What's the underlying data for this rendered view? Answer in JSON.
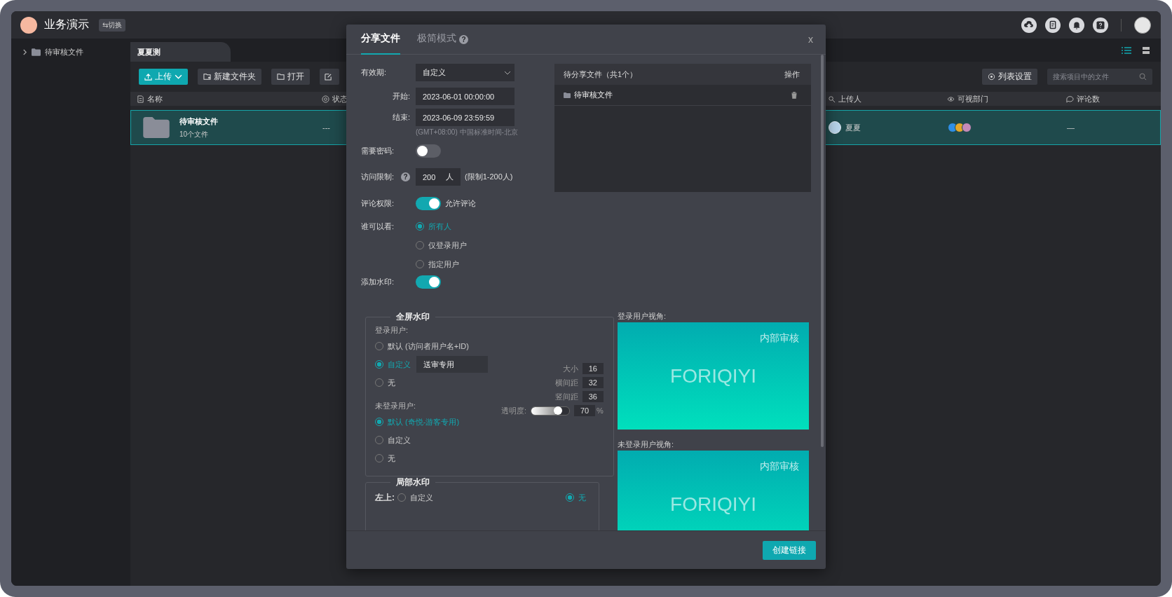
{
  "app": {
    "title": "业务演示",
    "switch_button": "⇆切换"
  },
  "sidebar": {
    "items": [
      {
        "label": "待审核文件",
        "expanded": false
      }
    ]
  },
  "breadcrumb_tab": "夏夏测",
  "toolbar": {
    "buttons": [
      {
        "kind": "upload",
        "label": "上传"
      },
      {
        "kind": "new-folder",
        "label": "新建文件夹"
      },
      {
        "kind": "open",
        "label": "打开"
      },
      {
        "kind": "edit"
      }
    ],
    "list_settings": "列表设置",
    "search": {
      "placeholder": "搜索项目中的文件"
    }
  },
  "table": {
    "columns": [
      {
        "kind": "name",
        "label": "名称"
      },
      {
        "kind": "status",
        "label": "状态"
      },
      {
        "kind": "uploader",
        "label": "上传人"
      },
      {
        "kind": "departments",
        "label": "可视部门"
      },
      {
        "kind": "comments",
        "label": "评论数"
      }
    ],
    "rows": [
      {
        "selected": true,
        "name": "待审核文件",
        "meta": "10个文件",
        "status": "---",
        "uploader": "夏夏",
        "departments": [
          {
            "color": "#2f8fe6"
          },
          {
            "color": "#e4a72a"
          },
          {
            "color": "#c58ab8"
          }
        ],
        "comments": "—"
      }
    ]
  },
  "dialog": {
    "tabs": [
      {
        "label": "分享文件",
        "selected": true
      },
      {
        "label": "极简模式",
        "selected": false,
        "help": "?"
      }
    ],
    "close": "x",
    "validity": {
      "label": "有效期:",
      "value": "自定义"
    },
    "start": {
      "label": "开始:",
      "value": "2023-06-01 00:00:00"
    },
    "end": {
      "label": "结束:",
      "value": "2023-06-09 23:59:59"
    },
    "timezone_note": "(GMT+08:00) 中国标准时间-北京",
    "password": {
      "label": "需要密码:",
      "on": false
    },
    "access_limit": {
      "label": "访问限制:",
      "value": "200",
      "unit": "人",
      "help": "?",
      "note": "(限制1-200人)"
    },
    "comments": {
      "label": "评论权限:",
      "on": true,
      "text": "允许评论"
    },
    "visibility": {
      "label": "谁可以看:",
      "options": [
        {
          "label": "所有人",
          "selected": true
        },
        {
          "label": "仅登录用户",
          "selected": false
        },
        {
          "label": "指定用户",
          "selected": false
        }
      ]
    },
    "watermark": {
      "label": "添加水印:",
      "on": true
    },
    "files_panel": {
      "title": "待分享文件（共1个）",
      "action_header": "操作",
      "files": [
        {
          "name": "待审核文件"
        }
      ]
    },
    "fullscreen_watermark": {
      "legend": "全屏水印",
      "logged_in": {
        "label": "登录用户:",
        "options": [
          {
            "label": "默认 (访问者用户名+ID)",
            "selected": false
          },
          {
            "label": "自定义",
            "selected": true,
            "value": "送审专用"
          },
          {
            "label": "无",
            "selected": false
          }
        ]
      },
      "guest": {
        "label": "未登录用户:",
        "options": [
          {
            "label": "默认 (奇悦-游客专用)",
            "selected": true
          },
          {
            "label": "自定义",
            "selected": false
          },
          {
            "label": "无",
            "selected": false
          }
        ]
      },
      "settings": [
        {
          "label": "大小",
          "value": "16"
        },
        {
          "label": "横间距",
          "value": "32"
        },
        {
          "label": "竖间距",
          "value": "36"
        }
      ],
      "opacity": {
        "label": "透明度:",
        "level": 0.7,
        "value": "70",
        "unit": "%"
      }
    },
    "local_watermark": {
      "legend": "局部水印",
      "rows": [
        {
          "label": "左上:",
          "options": [
            {
              "label": "自定义",
              "selected": false
            },
            {
              "label": "无",
              "selected": true
            }
          ]
        }
      ]
    },
    "previews": [
      {
        "label": "登录用户视角:",
        "corner_text": "内部审核",
        "center_text": "FORIQIYI"
      },
      {
        "label": "未登录用户视角:",
        "corner_text": "内部审核",
        "center_text": "FORIQIYI"
      }
    ],
    "create_button": "创建链接"
  }
}
